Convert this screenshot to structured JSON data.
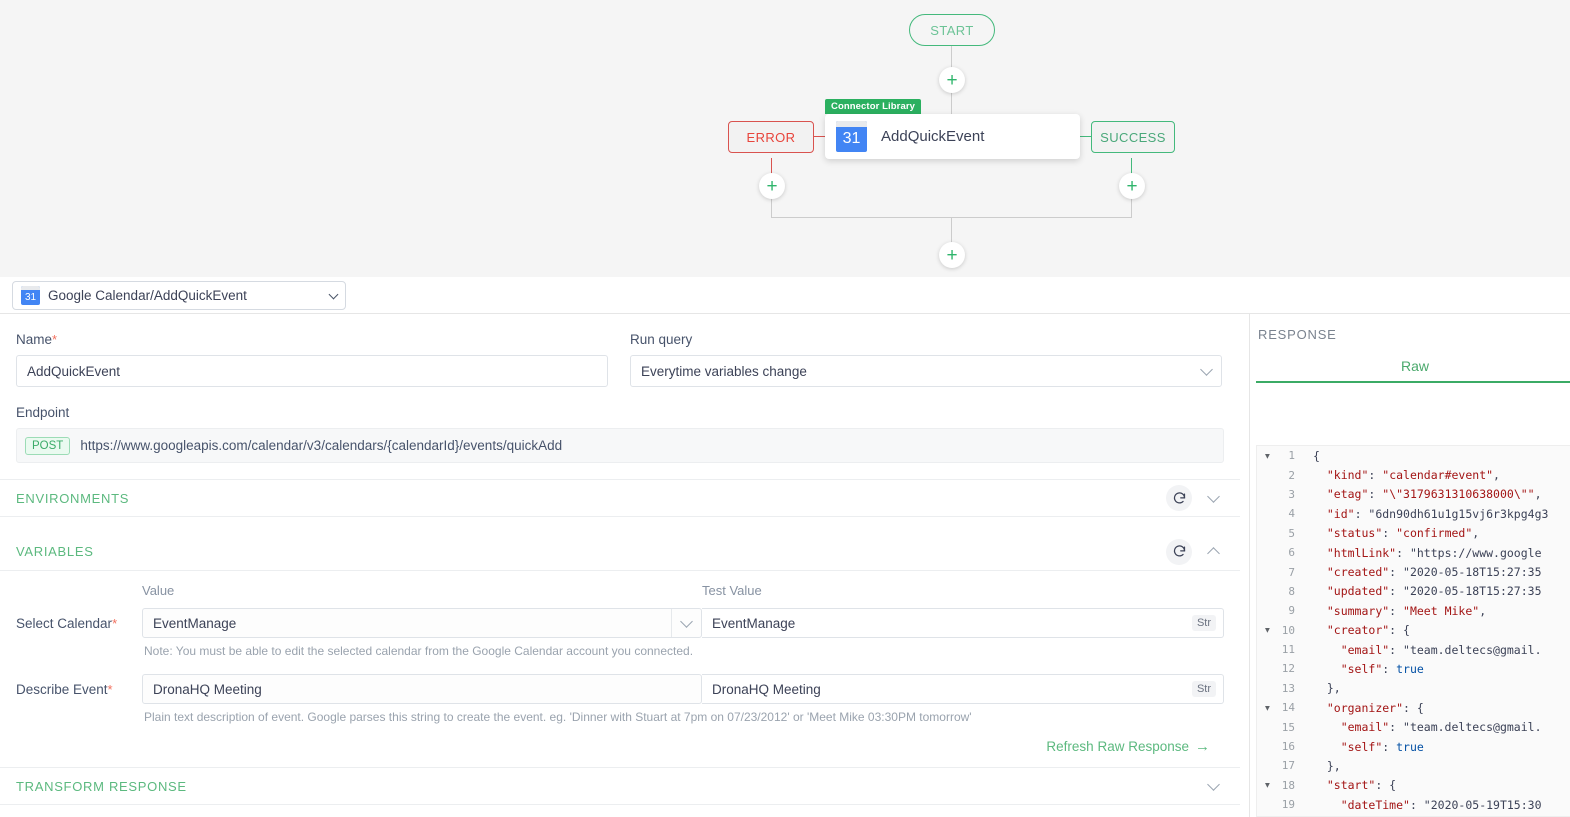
{
  "flow": {
    "start_label": "START",
    "error_label": "ERROR",
    "success_label": "SUCCESS",
    "node_badge": "Connector Library",
    "node_label": "AddQuickEvent",
    "calendar_icon_day": "31",
    "add_symbol": "+",
    "colors": {
      "start_border": "#44b97c",
      "error_border": "#d9534f",
      "error_text": "#e8453c",
      "success_border": "#44b97c",
      "success_text": "#4aa87a",
      "badge_bg": "#2bb060",
      "canvas_bg": "#f5f5f5",
      "calendar_blue": "#4285f4"
    }
  },
  "selector": {
    "icon_day": "31",
    "label": "Google Calendar/AddQuickEvent"
  },
  "form": {
    "name_label": "Name",
    "name_required": "*",
    "name_value": "AddQuickEvent",
    "run_query_label": "Run query",
    "run_query_value": "Everytime variables change",
    "endpoint_label": "Endpoint",
    "endpoint_method": "POST",
    "endpoint_url": "https://www.googleapis.com/calendar/v3/calendars/{calendarId}/events/quickAdd"
  },
  "sections": {
    "environments_title": "ENVIRONMENTS",
    "variables_title": "VARIABLES",
    "transform_title": "TRANSFORM RESPONSE"
  },
  "variables": {
    "col_value": "Value",
    "col_test_value": "Test Value",
    "rows": [
      {
        "label": "Select Calendar",
        "required": "*",
        "value": "EventManage",
        "test_value": "EventManage",
        "type_badge": "Str",
        "has_dropdown": true,
        "note": "Note: You must be able to edit the selected calendar from the Google Calendar account you connected."
      },
      {
        "label": "Describe Event",
        "required": "*",
        "value": "DronaHQ Meeting",
        "test_value": "DronaHQ Meeting",
        "type_badge": "Str",
        "has_dropdown": false,
        "note": "Plain text description of event. Google parses this string to create the event. eg. 'Dinner with Stuart at 7pm on 07/23/2012' or 'Meet Mike 03:30PM tomorrow'"
      }
    ],
    "refresh_link": "Refresh Raw Response",
    "refresh_arrow": "→"
  },
  "response": {
    "title": "RESPONSE",
    "tab_raw": "Raw",
    "json_lines": [
      {
        "n": "1",
        "fold": true,
        "code": "{"
      },
      {
        "n": "2",
        "fold": false,
        "code": "  \"kind\": \"calendar#event\","
      },
      {
        "n": "3",
        "fold": false,
        "code": "  \"etag\": \"\\\"3179631310638000\\\"\","
      },
      {
        "n": "4",
        "fold": false,
        "code": "  \"id\": \"6dn90dh61u1g15vj6r3kpg4g3"
      },
      {
        "n": "5",
        "fold": false,
        "code": "  \"status\": \"confirmed\","
      },
      {
        "n": "6",
        "fold": false,
        "code": "  \"htmlLink\": \"https://www.google"
      },
      {
        "n": "7",
        "fold": false,
        "code": "  \"created\": \"2020-05-18T15:27:35"
      },
      {
        "n": "8",
        "fold": false,
        "code": "  \"updated\": \"2020-05-18T15:27:35"
      },
      {
        "n": "9",
        "fold": false,
        "code": "  \"summary\": \"Meet Mike\","
      },
      {
        "n": "10",
        "fold": true,
        "code": "  \"creator\": {"
      },
      {
        "n": "11",
        "fold": false,
        "code": "    \"email\": \"team.deltecs@gmail."
      },
      {
        "n": "12",
        "fold": false,
        "code": "    \"self\": true"
      },
      {
        "n": "13",
        "fold": false,
        "code": "  },"
      },
      {
        "n": "14",
        "fold": true,
        "code": "  \"organizer\": {"
      },
      {
        "n": "15",
        "fold": false,
        "code": "    \"email\": \"team.deltecs@gmail."
      },
      {
        "n": "16",
        "fold": false,
        "code": "    \"self\": true"
      },
      {
        "n": "17",
        "fold": false,
        "code": "  },"
      },
      {
        "n": "18",
        "fold": true,
        "code": "  \"start\": {"
      },
      {
        "n": "19",
        "fold": false,
        "code": "    \"dateTime\": \"2020-05-19T15:30"
      }
    ]
  }
}
